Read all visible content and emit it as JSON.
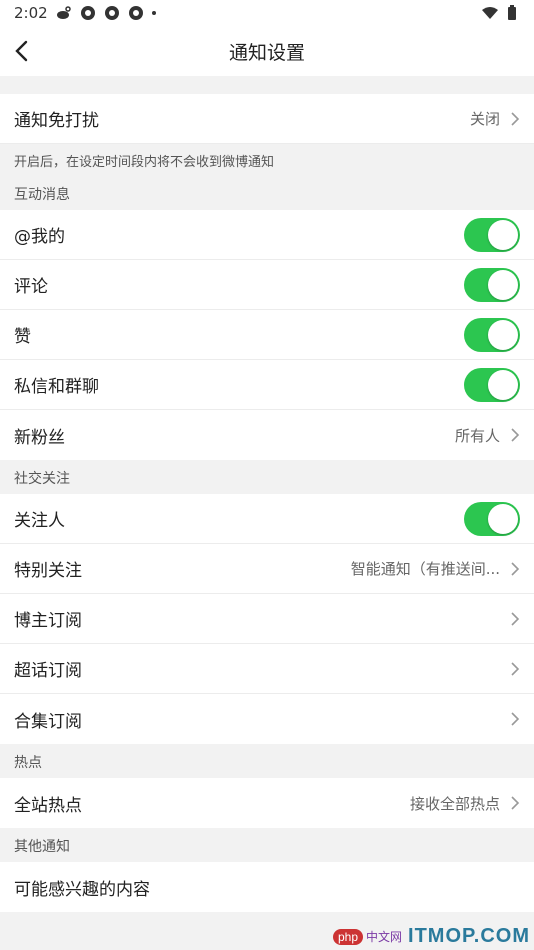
{
  "status_bar": {
    "time": "2:02"
  },
  "header": {
    "title": "通知设置"
  },
  "dnd": {
    "label": "通知免打扰",
    "value": "关闭",
    "hint": "开启后，在设定时间段内将不会收到微博通知"
  },
  "interactive": {
    "section": "互动消息",
    "items": [
      {
        "label": "@我的",
        "toggle": true
      },
      {
        "label": "评论",
        "toggle": true
      },
      {
        "label": "赞",
        "toggle": true
      },
      {
        "label": "私信和群聊",
        "toggle": true
      },
      {
        "label": "新粉丝",
        "value": "所有人"
      }
    ]
  },
  "social": {
    "section": "社交关注",
    "items": [
      {
        "label": "关注人",
        "toggle": true
      },
      {
        "label": "特别关注",
        "value": "智能通知（有推送间..."
      },
      {
        "label": "博主订阅"
      },
      {
        "label": "超话订阅"
      },
      {
        "label": "合集订阅"
      }
    ]
  },
  "hot": {
    "section": "热点",
    "items": [
      {
        "label": "全站热点",
        "value": "接收全部热点"
      }
    ]
  },
  "other": {
    "section": "其他通知",
    "items": [
      {
        "label": "可能感兴趣的内容"
      }
    ]
  },
  "watermark": {
    "php": "php",
    "cn": "中文网",
    "brand": "ITMOP.COM"
  },
  "colors": {
    "toggle_on": "#2cc650"
  }
}
